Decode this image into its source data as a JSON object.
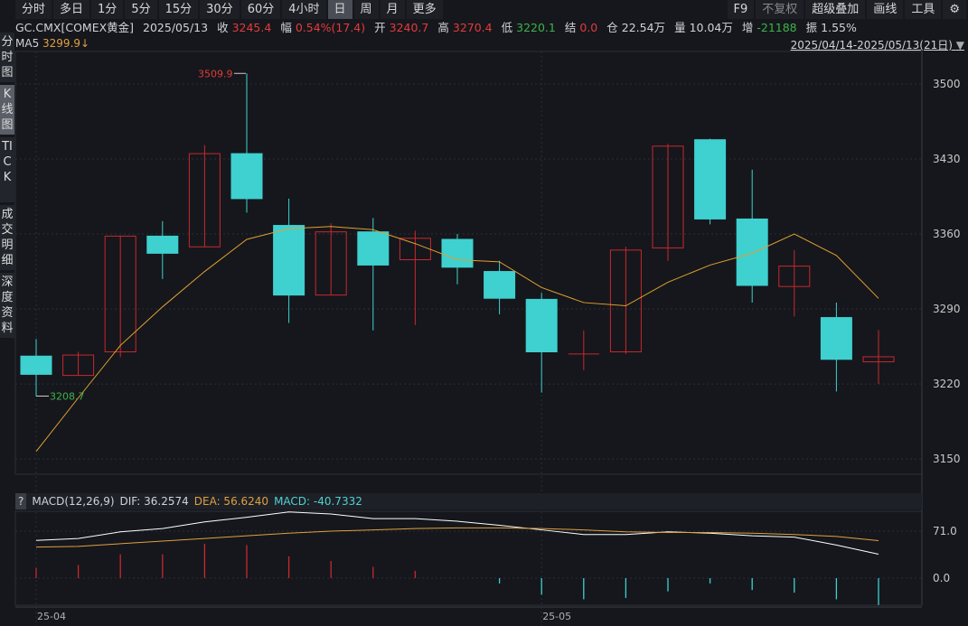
{
  "toolbar": {
    "periods": [
      "分时",
      "多日",
      "1分",
      "5分",
      "15分",
      "30分",
      "60分",
      "4小时",
      "日",
      "周",
      "月",
      "更多"
    ],
    "active": "日",
    "right": [
      "F9",
      "不复权",
      "超级叠加",
      "画线",
      "工具"
    ]
  },
  "info": {
    "symbol": "GC.CMX[COMEX黄金]",
    "date": "2025/05/13",
    "close_label": "收",
    "close": "3245.4",
    "chg_label": "幅",
    "chg": "0.54%(17.4)",
    "open_label": "开",
    "open": "3240.7",
    "high_label": "高",
    "high": "3270.4",
    "low_label": "低",
    "low": "3220.1",
    "settle_label": "结",
    "settle": "0.0",
    "oi_label": "仓",
    "oi": "22.54万",
    "vol_label": "量",
    "vol": "10.04万",
    "inc_label": "增",
    "inc": "-21188",
    "amp_label": "振",
    "amp": "1.55%"
  },
  "ma": {
    "label": "MA5",
    "value": "3299.9↓"
  },
  "range": "2025/04/14-2025/05/13(21日)",
  "sidebar": [
    "分时图",
    "K线图",
    "TICK",
    "成交明细",
    "深度资料"
  ],
  "sidebar_active": "K线图",
  "macd": {
    "help": "?",
    "title": "MACD(12,26,9)",
    "dif": "DIF: 36.2574",
    "dea": "DEA: 56.6240",
    "macd": "MACD: -40.7332"
  },
  "colors": {
    "up": "#c8282e",
    "down": "#3fd0d0",
    "ma5": "#e0a030",
    "dif": "#ffffff",
    "dea": "#e0a040"
  },
  "chart_data": {
    "type": "candlestick",
    "price_ticks": [
      3500,
      3430,
      3360,
      3290,
      3220,
      3150
    ],
    "ylim": [
      3146,
      3545
    ],
    "date_labels": [
      {
        "index": 0,
        "label": "25-04"
      },
      {
        "index": 12,
        "label": "25-05"
      }
    ],
    "annotations": {
      "max": "3509.9",
      "min": "3208.7"
    },
    "ohlc": [
      [
        3246,
        3262,
        3208.7,
        3229
      ],
      [
        3228,
        3250,
        3228,
        3247
      ],
      [
        3250,
        3358,
        3245,
        3358
      ],
      [
        3358,
        3372,
        3318,
        3342
      ],
      [
        3348,
        3443,
        3348,
        3435
      ],
      [
        3435,
        3509.9,
        3380,
        3393
      ],
      [
        3368,
        3393,
        3277,
        3303
      ],
      [
        3303,
        3370,
        3303,
        3362
      ],
      [
        3362,
        3375,
        3270,
        3331
      ],
      [
        3336,
        3363,
        3275,
        3356
      ],
      [
        3355,
        3360,
        3313,
        3329
      ],
      [
        3325,
        3335,
        3285,
        3300
      ],
      [
        3299,
        3305,
        3212,
        3250
      ],
      [
        3248,
        3270,
        3233,
        3248
      ],
      [
        3250,
        3348,
        3248,
        3345
      ],
      [
        3347,
        3444,
        3335,
        3442
      ],
      [
        3448,
        3449,
        3369,
        3374
      ],
      [
        3374,
        3420,
        3296,
        3312
      ],
      [
        3311,
        3345,
        3283,
        3330
      ],
      [
        3282,
        3296,
        3213,
        3243
      ],
      [
        3240.7,
        3270.4,
        3220.1,
        3245.4
      ]
    ],
    "ma5": [
      3157,
      3207,
      3256,
      3292,
      3325,
      3355,
      3365,
      3367,
      3364,
      3351,
      3336,
      3334,
      3310,
      3296,
      3293,
      3315,
      3331,
      3342,
      3360,
      3340,
      3299.9
    ],
    "macd_ticks": [
      71.0,
      0.0
    ],
    "dif": [
      57,
      60,
      70,
      75,
      85,
      92,
      100,
      97,
      90,
      90,
      86,
      80,
      73,
      66,
      66,
      70,
      68,
      64,
      62,
      50,
      36.26
    ],
    "dea": [
      47,
      48,
      52,
      56,
      60,
      64,
      68,
      71,
      73,
      75,
      76,
      76,
      75,
      73,
      70,
      69,
      69,
      68,
      66,
      63,
      56.62
    ],
    "hist": [
      15,
      20,
      36,
      36,
      52,
      50,
      33,
      26,
      17,
      11,
      0,
      -8,
      -25,
      -32,
      -30,
      -20,
      -8,
      -18,
      -22,
      -32,
      -40.73
    ]
  }
}
